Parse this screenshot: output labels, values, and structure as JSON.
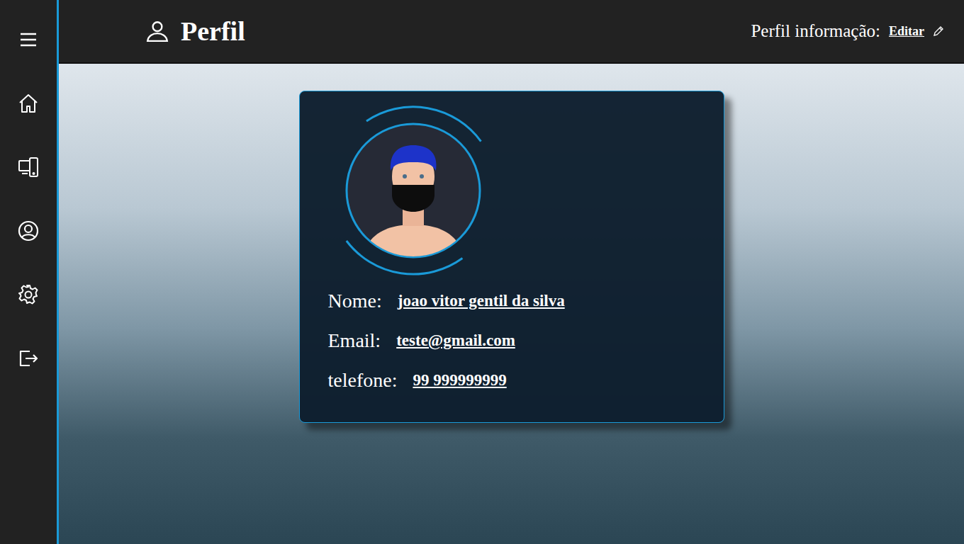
{
  "header": {
    "title": "Perfil",
    "info_label": "Perfil informação:",
    "edit_link": "Editar"
  },
  "profile": {
    "fields": [
      {
        "label": "Nome:",
        "value": "joao vitor gentil da silva"
      },
      {
        "label": "Email:",
        "value": "teste@gmail.com"
      },
      {
        "label": "telefone:",
        "value": "99 999999999"
      }
    ]
  }
}
